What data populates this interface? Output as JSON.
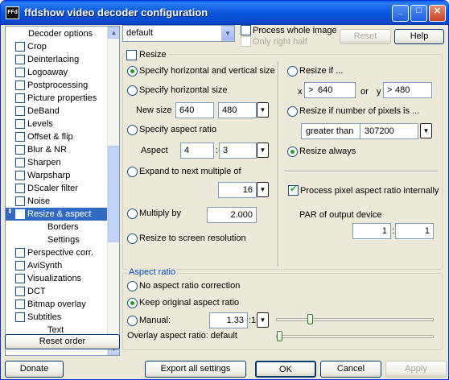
{
  "title": "ffdshow video decoder configuration",
  "title_icon": "FFd",
  "window_buttons": {
    "minimize": "_",
    "maximize": "□",
    "close": "✕"
  },
  "tree": {
    "items": [
      {
        "label": "Decoder options",
        "type": "head"
      },
      {
        "label": "Crop"
      },
      {
        "label": "Deinterlacing"
      },
      {
        "label": "Logoaway"
      },
      {
        "label": "Postprocessing"
      },
      {
        "label": "Picture properties"
      },
      {
        "label": "DeBand"
      },
      {
        "label": "Levels"
      },
      {
        "label": "Offset & flip"
      },
      {
        "label": "Blur & NR"
      },
      {
        "label": "Sharpen"
      },
      {
        "label": "Warpsharp"
      },
      {
        "label": "DScaler filter"
      },
      {
        "label": "Noise"
      },
      {
        "label": "Resize & aspect",
        "selected": true
      },
      {
        "label": "Borders",
        "type": "sub"
      },
      {
        "label": "Settings",
        "type": "sub"
      },
      {
        "label": "Perspective corr."
      },
      {
        "label": "AviSynth"
      },
      {
        "label": "Visualizations"
      },
      {
        "label": "DCT"
      },
      {
        "label": "Bitmap overlay"
      },
      {
        "label": "Subtitles"
      },
      {
        "label": "Text",
        "type": "sub"
      }
    ],
    "selected_marker": "⬍"
  },
  "reset_order": "Reset order",
  "preset": {
    "value": "default"
  },
  "process_whole_image": "Process whole image",
  "only_right_half": "Only right half",
  "reset": "Reset",
  "help": "Help",
  "resize": {
    "label": "Resize",
    "opt_hv": "Specify horizontal and vertical size",
    "opt_h": "Specify horizontal size",
    "new_size_label": "New size",
    "new_w": "640",
    "new_h": "480",
    "opt_aspect": "Specify aspect ratio",
    "aspect_label": "Aspect",
    "aspect_a": "4",
    "aspect_sep": ":",
    "aspect_b": "3",
    "opt_expand": "Expand to next multiple of",
    "multiple": "16",
    "opt_multiply": "Multiply by",
    "multiply": "2.000",
    "opt_screen": "Resize to screen resolution"
  },
  "condition": {
    "opt_if": "Resize if ...",
    "x_label": "x",
    "gt": ">",
    "x_val": "640",
    "or": "or",
    "y_label": "y",
    "y_val": "480",
    "opt_pixels": "Resize if number of pixels is ...",
    "cmp": "greater than",
    "pixels": "307200",
    "opt_always": "Resize always",
    "par_internal": "Process pixel aspect ratio internally",
    "par_output_label": "PAR of output device",
    "par_a": "1",
    "par_sep": ":",
    "par_b": "1"
  },
  "aspect": {
    "group": "Aspect ratio",
    "opt_none": "No aspect ratio correction",
    "opt_keep": "Keep original aspect ratio",
    "opt_manual": "Manual:",
    "manual_val": "1.33",
    "manual_suffix": ":1",
    "manual_slider": 0.2,
    "overlay": "Overlay aspect ratio: default",
    "overlay_slider": 0
  },
  "buttons": {
    "donate": "Donate",
    "export": "Export all settings",
    "ok": "OK",
    "cancel": "Cancel",
    "apply": "Apply"
  },
  "arrow_down": "▼",
  "arrow_up": "▲"
}
